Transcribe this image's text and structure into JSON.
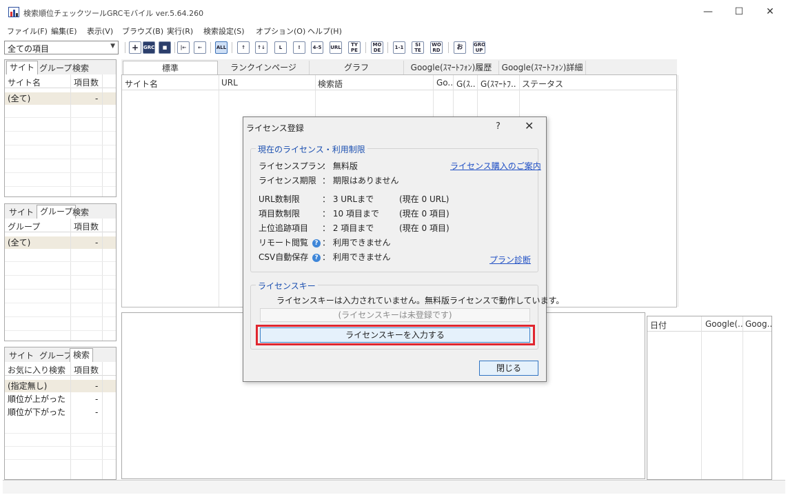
{
  "window": {
    "title": "検索順位チェックツールGRCモバイル ver.5.64.260",
    "minimize": "—",
    "maximize": "☐",
    "close": "✕"
  },
  "menu": [
    "ファイル(F)",
    "編集(E)",
    "表示(V)",
    "ブラウズ(B)",
    "実行(R)",
    "検索設定(S)",
    "オプション(O)",
    "ヘルプ(H)"
  ],
  "toolbar": {
    "filter_value": "全ての項目",
    "buttons": [
      "+",
      "GRC mob",
      "■",
      "|←",
      "←",
      "ALL",
      "↑",
      "↑↓",
      "L",
      "!",
      "4-5",
      "URL",
      "TY PE",
      "MO DE",
      "1-1",
      "SI TE",
      "WO RD",
      "お",
      "GRO UP"
    ]
  },
  "left_panels": {
    "panel1": {
      "tabs": [
        "サイト",
        "グループ",
        "検索"
      ],
      "col1": "サイト名",
      "col2": "項目数",
      "rows": [
        {
          "name": "(全て)",
          "count": "-"
        }
      ]
    },
    "panel2": {
      "tabs": [
        "サイト",
        "グループ",
        "検索"
      ],
      "col1": "グループ",
      "col2": "項目数",
      "rows": [
        {
          "name": "(全て)",
          "count": "-"
        }
      ]
    },
    "panel3": {
      "tabs": [
        "サイト",
        "グループ",
        "検索"
      ],
      "col1": "お気に入り検索",
      "col2": "項目数",
      "rows": [
        {
          "name": "(指定無し)",
          "count": "-"
        },
        {
          "name": "順位が上がった",
          "count": "-"
        },
        {
          "name": "順位が下がった",
          "count": "-"
        }
      ]
    }
  },
  "main": {
    "tabs": [
      "標準",
      "ランクインページ",
      "グラフ",
      "Google(ｽﾏｰﾄﾌｫﾝ)履歴",
      "Google(ｽﾏｰﾄﾌｫﾝ)詳細"
    ],
    "columns": [
      "サイト名",
      "URL",
      "検索語",
      "Go..",
      "G(ｽ..",
      "G(ｽﾏｰﾄﾌ..",
      "ステータス"
    ]
  },
  "date_grid": {
    "columns": [
      "日付",
      "Google(..",
      "Goog.."
    ]
  },
  "dialog": {
    "title": "ライセンス登録",
    "help": "?",
    "close": "✕",
    "current_group": "現在のライセンス・利用制限",
    "plan_label": "ライセンスプラン",
    "plan_value": "： 無料版",
    "purchase_link": "ライセンス購入のご案内",
    "period_label": "ライセンス期限",
    "period_value": "： 期限はありません",
    "url_label": "URL数制限",
    "url_value": "： 3 URLまで",
    "url_current": "(現在 0 URL)",
    "item_label": "項目数制限",
    "item_value": "： 10 項目まで",
    "item_current": "(現在 0 項目)",
    "track_label": "上位追跡項目",
    "track_value": "： 2 項目まで",
    "track_current": "(現在 0 項目)",
    "remote_label": "リモート閲覧",
    "remote_value": "： 利用できません",
    "csv_label": "CSV自動保存",
    "csv_value": "： 利用できません",
    "plan_diag_link": "プラン診断",
    "key_group": "ライセンスキー",
    "key_message": "ライセンスキーは入力されていません。無料版ライセンスで動作しています。",
    "key_field": "(ライセンスキーは未登録です)",
    "enter_key_button": "ライセンスキーを入力する",
    "close_button": "閉じる"
  },
  "colors": {
    "highlight": "#e0262f",
    "link": "#1f4fc4",
    "group_title": "#1b4fb0",
    "selected_row": "#efeade"
  }
}
